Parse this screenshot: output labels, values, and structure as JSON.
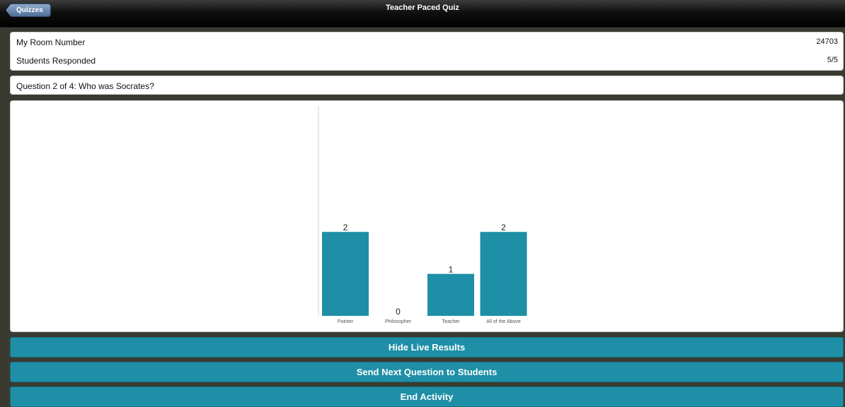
{
  "header": {
    "back_label": "Quizzes",
    "title": "Teacher Paced Quiz"
  },
  "info": {
    "room_label": "My Room Number",
    "room_value": "24703",
    "responded_label": "Students Responded",
    "responded_value": "5/5"
  },
  "question": {
    "text": "Question 2 of 4: Who was Socrates?"
  },
  "chart_data": {
    "type": "bar",
    "categories": [
      "Painter",
      "Philosopher",
      "Teacher",
      "All of the Above"
    ],
    "values": [
      2,
      0,
      1,
      2
    ],
    "title": "",
    "xlabel": "",
    "ylabel": "",
    "ylim": [
      0,
      5
    ],
    "color": "#1e8fa6"
  },
  "actions": {
    "hide_results": "Hide Live Results",
    "send_next": "Send Next Question to Students",
    "end_activity": "End Activity"
  },
  "colors": {
    "accent": "#1e8fa6",
    "background": "#3b3a31"
  }
}
